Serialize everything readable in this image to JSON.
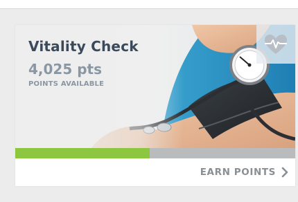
{
  "card": {
    "title": "Vitality Check",
    "points": "4,025 pts",
    "points_label": "POINTS AVAILABLE",
    "progress_fraction": 0.48,
    "link_label": "EARN POINTS",
    "icon": "heart-pulse-icon"
  },
  "colors": {
    "accent_green": "#8dc63f",
    "title_color": "#3b4a5a",
    "muted_text": "#8a97a3",
    "progress_track": "#b9bbbd"
  }
}
